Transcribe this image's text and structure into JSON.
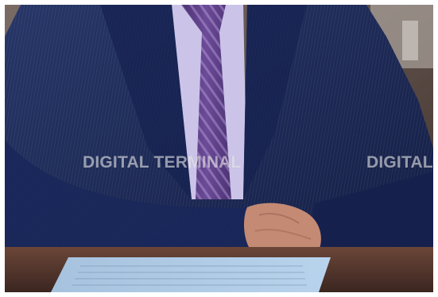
{
  "image": {
    "subject": "suit-sleeve-tie-hand-document",
    "colors": {
      "suit": "#1c2a5a",
      "suit_shadow": "#101a3d",
      "shirt": "#c9c2e6",
      "tie": "#5b3d86",
      "desk": "#5a3a30",
      "paper": "#a9c7e4",
      "skin": "#c48a74",
      "background": "#8a7a70"
    }
  },
  "watermarks": [
    {
      "text": "DIGITAL TERMINAL"
    },
    {
      "text": "DIGITAL"
    }
  ]
}
